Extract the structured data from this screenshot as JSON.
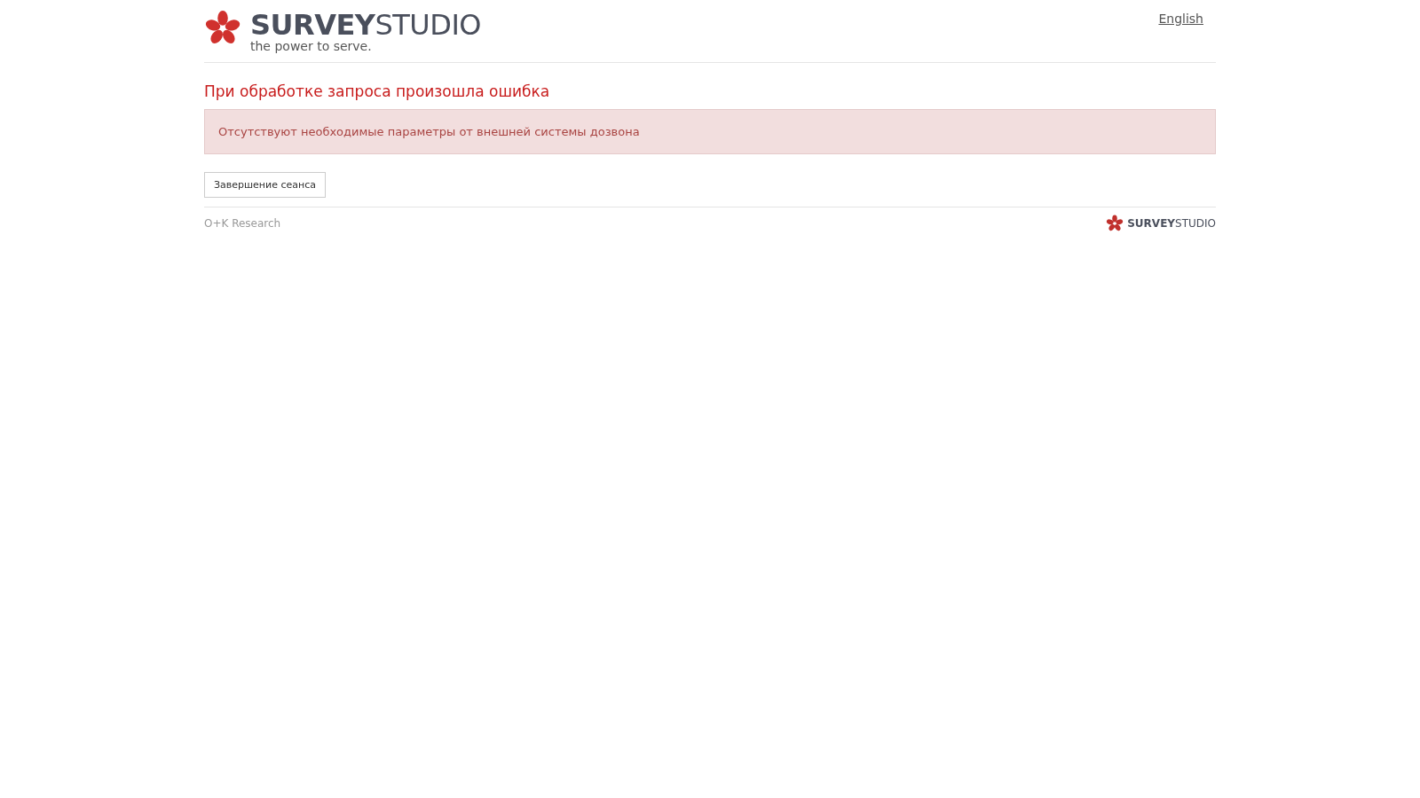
{
  "header": {
    "logo": "**SURVEY**STUDIO",
    "tagline": "the power to serve.",
    "language_link": "English"
  },
  "error": {
    "title": "При обработке запроса произошла ошибка",
    "message": "Отсутствуют необходимые параметры от внешней системы дозвона"
  },
  "end_session_button": "Завершение сеанса",
  "footer": {
    "company": "O+K Research",
    "logo": "**SURVEY**STUDIO"
  }
}
